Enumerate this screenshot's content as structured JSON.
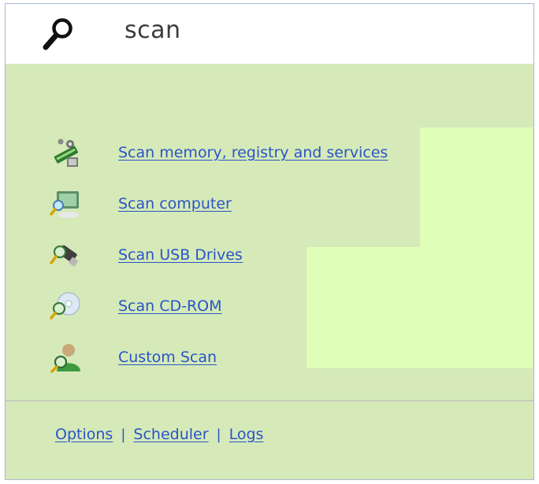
{
  "header": {
    "title": "scan",
    "icon": "search-icon"
  },
  "scan_options": [
    {
      "label": "Scan memory, registry and services",
      "icon": "memory-scan-icon"
    },
    {
      "label": "Scan computer",
      "icon": "computer-scan-icon"
    },
    {
      "label": "Scan USB Drives",
      "icon": "usb-scan-icon"
    },
    {
      "label": "Scan CD-ROM",
      "icon": "cdrom-scan-icon"
    },
    {
      "label": "Custom Scan",
      "icon": "custom-scan-icon"
    }
  ],
  "footer": {
    "links": [
      "Options",
      "Scheduler",
      "Logs"
    ],
    "separator": "|"
  },
  "colors": {
    "background": "#d5eab8",
    "highlight_panel": "#dfffb9",
    "link": "#2a54c7"
  }
}
